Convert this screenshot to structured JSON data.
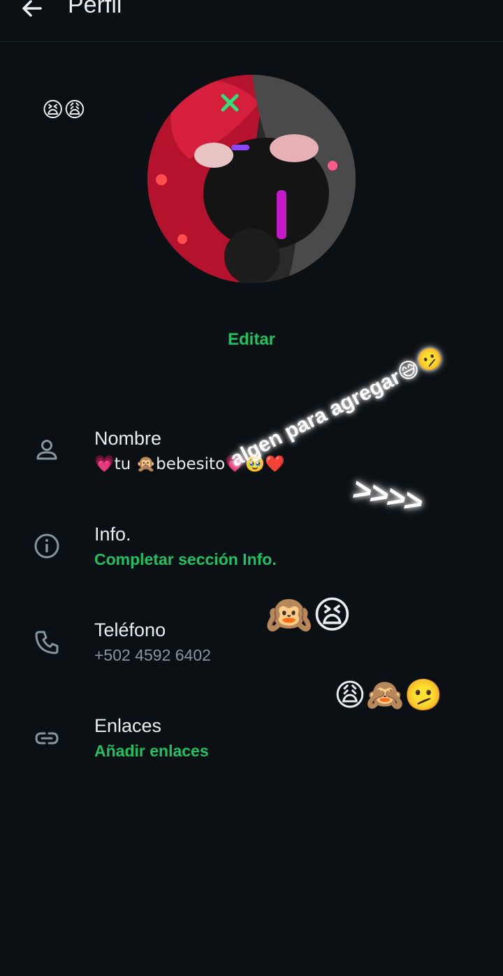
{
  "header": {
    "title": "Perfil"
  },
  "profile": {
    "edit_label": "Editar"
  },
  "rows": [
    {
      "label": "Nombre",
      "value": "💗tu 🙊bebesito💗🥹❤️"
    },
    {
      "label": "Info.",
      "value": "Completar sección Info."
    },
    {
      "label": "Teléfono",
      "value": "+502 4592 6402"
    },
    {
      "label": "Enlaces",
      "value": "Añadir enlaces"
    }
  ],
  "stickers": {
    "top_left": "😫😩",
    "caption": "algen para agregar",
    "caption_emoji": "😅🫤",
    "arrows": ">>>>",
    "phone_row": "🙉😫",
    "links_row": "😩🙈🫤"
  },
  "colors": {
    "background": "#0b1014",
    "accent": "#21c063",
    "muted": "#8696a0",
    "text": "#e9edef"
  }
}
